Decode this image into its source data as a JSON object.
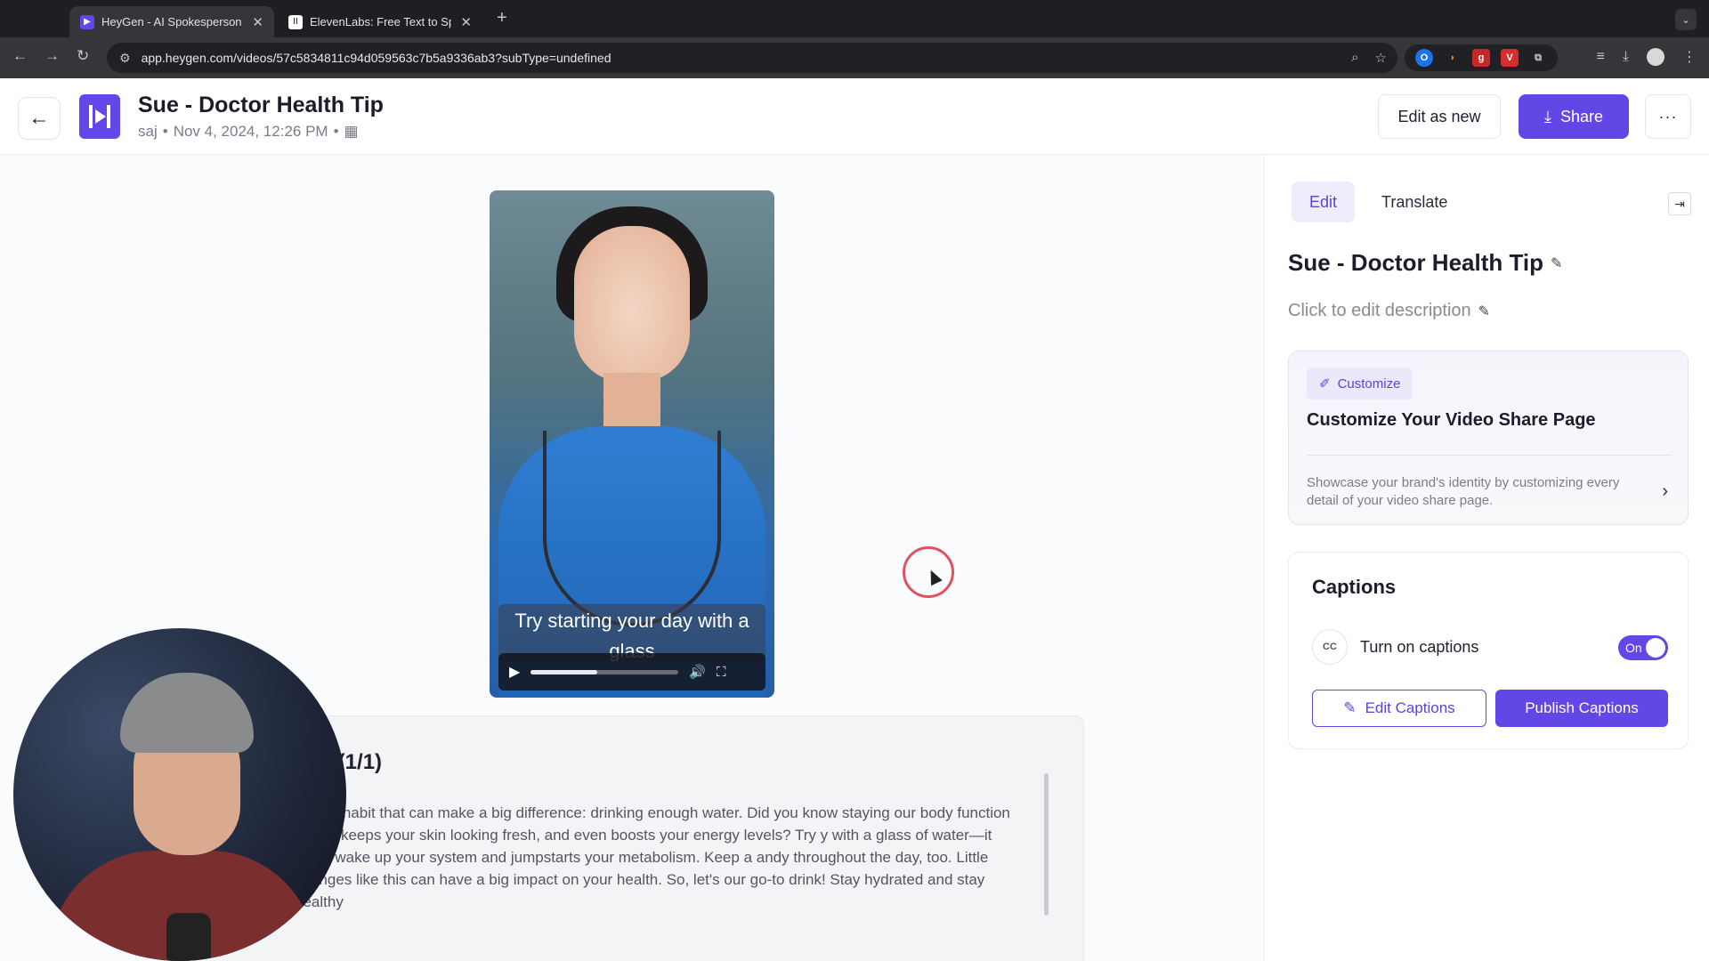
{
  "browser": {
    "tabs": [
      {
        "title": "HeyGen - AI Spokesperson Video",
        "active": true,
        "favicon_color": "#6447e8"
      },
      {
        "title": "ElevenLabs: Free Text to Speech",
        "active": false,
        "favicon_color": "#ffffff"
      }
    ],
    "new_tab": "+",
    "url": "app.heygen.com/videos/57c5834811c94d059563c7b5a9336ab3?subType=undefined",
    "extensions": [
      {
        "glyph": "O",
        "color": "#1a73e8"
      },
      {
        "glyph": "◗",
        "color": "#e08a1e"
      },
      {
        "glyph": "g",
        "color": "#c62828"
      },
      {
        "glyph": "V",
        "color": "#d32f2f"
      },
      {
        "glyph": "⧉",
        "color": "#5f6368"
      }
    ]
  },
  "header": {
    "back_icon": "←",
    "title": "Sue - Doctor Health Tip",
    "meta_author": "saj",
    "meta_date": "Nov 4, 2024, 12:26 PM",
    "edit_as_new": "Edit as new",
    "share": "Share",
    "more": "···"
  },
  "video": {
    "caption": "Try starting your day with a glass",
    "progress": 0.45
  },
  "transcript": {
    "title": "ew (1/1)",
    "text": "simple habit that can make a big difference: drinking enough water. Did you know staying our body function better, keeps your skin looking fresh, and even boosts your energy levels? Try y with a glass of water—it helps wake up your system and jumpstarts your metabolism. Keep a andy throughout the day, too. Little changes like this can have a big impact on your health. So, let's our go-to drink! Stay hydrated and stay healthy"
  },
  "panel": {
    "tabs": [
      "Edit",
      "Translate"
    ],
    "title": "Sue - Doctor Health Tip",
    "description_placeholder": "Click to edit description",
    "customize": {
      "badge": "Customize",
      "heading": "Customize Your Video Share Page",
      "text": "Showcase your brand's identity by customizing every detail of your video share page."
    },
    "captions": {
      "heading": "Captions",
      "cc_label": "CC",
      "toggle_label": "Turn on captions",
      "toggle_state": "On",
      "edit_button": "Edit Captions",
      "publish_button": "Publish Captions"
    }
  },
  "colors": {
    "accent": "#6346e6",
    "accent_soft": "#eeedfb"
  }
}
